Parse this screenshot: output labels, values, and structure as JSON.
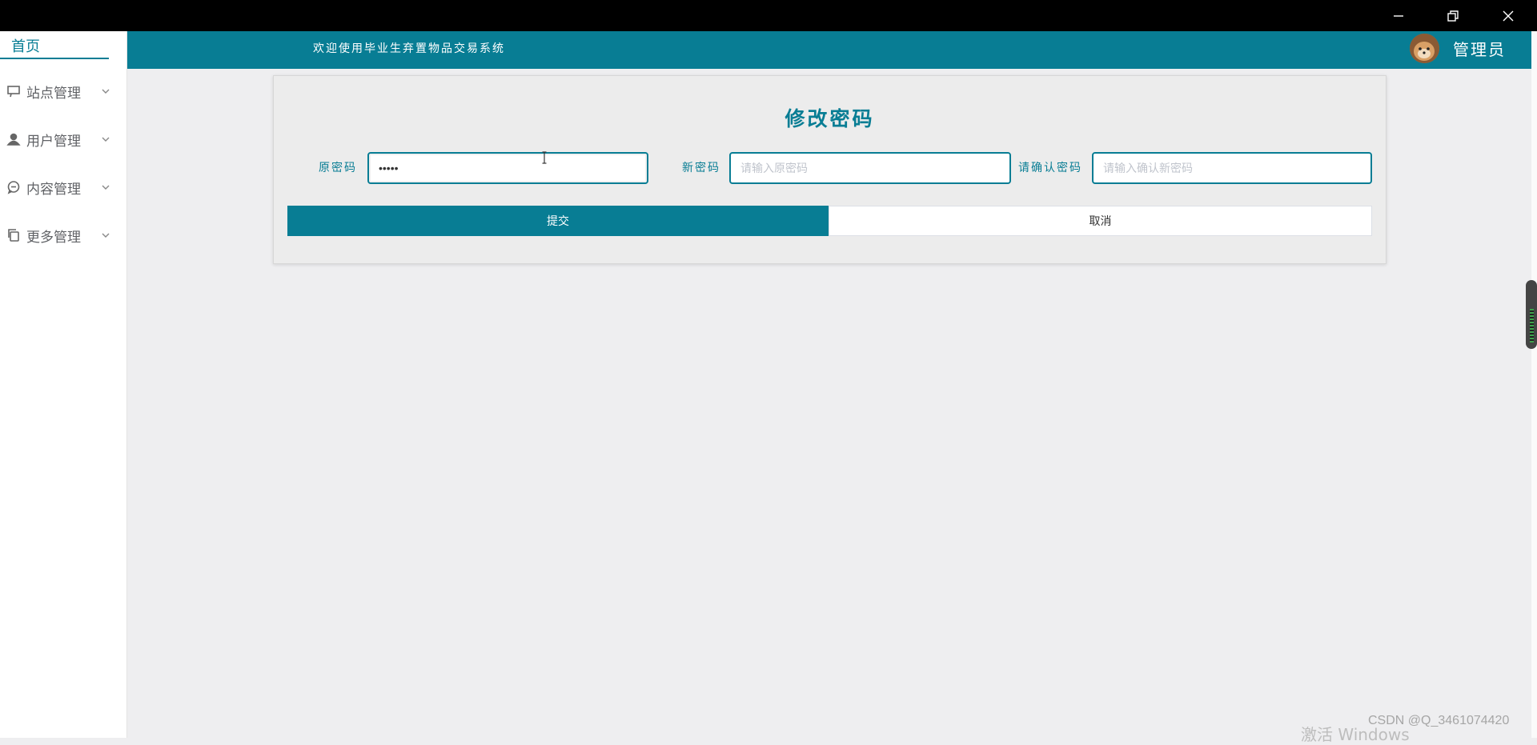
{
  "window": {
    "minimize_icon": "minimize-icon",
    "restore_icon": "restore-icon",
    "close_icon": "close-icon"
  },
  "sidebar": {
    "home": "首页",
    "items": [
      {
        "label": "站点管理",
        "icon": "desktop-icon"
      },
      {
        "label": "用户管理",
        "icon": "user-icon"
      },
      {
        "label": "内容管理",
        "icon": "chat-icon"
      },
      {
        "label": "更多管理",
        "icon": "copy-icon"
      }
    ]
  },
  "header": {
    "welcome": "欢迎使用毕业生弃置物品交易系统",
    "user_name": "管理员"
  },
  "form": {
    "title": "修改密码",
    "old_password_label": "原密码",
    "old_password_value": "•••••",
    "new_password_label": "新密码",
    "new_password_placeholder": "请输入原密码",
    "confirm_password_label": "请确认密码",
    "confirm_password_placeholder": "请输入确认新密码",
    "submit_label": "提交",
    "cancel_label": "取消"
  },
  "watermark": {
    "activate_windows": "激活 Windows",
    "csdn": "CSDN @Q_3461074420"
  },
  "colors": {
    "primary": "#087d94",
    "background": "#eeeef0"
  }
}
